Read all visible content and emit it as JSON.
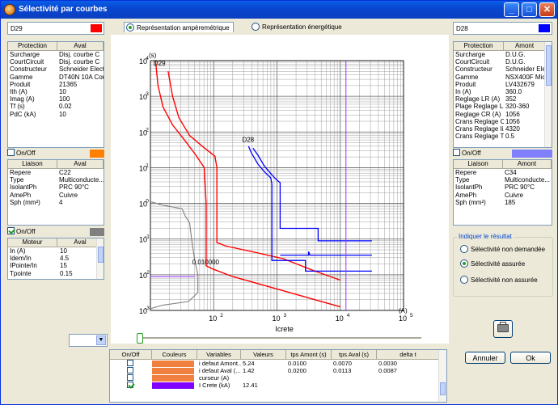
{
  "window": {
    "title": "Sélectivité par courbes"
  },
  "left": {
    "device_select": "D29",
    "prot_headers": [
      "Protection",
      "Aval"
    ],
    "prot_rows": [
      [
        "Surcharge",
        "Disj. courbe C"
      ],
      [
        "CourtCircuit",
        "Disj. courbe C"
      ],
      [
        "Constructeur",
        "Schneider Electric"
      ],
      [
        "Gamme",
        "DT40N 10A Cou..."
      ],
      [
        "Produit",
        "21365"
      ],
      [
        "Ith (A)",
        "10"
      ],
      [
        "Imag (A)",
        "100"
      ],
      [
        "Tf (s)",
        "0.02"
      ],
      [
        "PdC (kA)",
        "10"
      ]
    ],
    "onoff1": "On/Off",
    "liaison_headers": [
      "Liaison",
      "Aval"
    ],
    "liaison_rows": [
      [
        "Repere",
        "C22"
      ],
      [
        "Type",
        "Multiconducte..."
      ],
      [
        "IsolantPh",
        "PRC 90°C"
      ],
      [
        "AmePh",
        "Cuivre"
      ],
      [
        "Sph (mm²)",
        "4"
      ]
    ],
    "onoff2": "On/Off",
    "moteur_headers": [
      "Moteur",
      "Aval"
    ],
    "moteur_rows": [
      [
        "In (A)",
        "10"
      ],
      [
        "Idem/In",
        "4.5"
      ],
      [
        "IPointe/In",
        "15"
      ],
      [
        "Tpointe",
        "0.15"
      ]
    ],
    "zoom_select": ""
  },
  "right": {
    "device_select": "D28",
    "prot_headers": [
      "Protection",
      "Amont"
    ],
    "prot_rows": [
      [
        "Surcharge",
        "D.U.G."
      ],
      [
        "CourtCircuit",
        "D.U.G."
      ],
      [
        "Constructeur",
        "Schneider Elec"
      ],
      [
        "Gamme",
        "NSX400F Mic"
      ],
      [
        "Produit",
        "LV432679"
      ],
      [
        "In (A)",
        "360.0"
      ],
      [
        "Reglage LR (A)",
        "352"
      ],
      [
        "Plage Reglage L...",
        "320-360"
      ],
      [
        "Reglage CR (A)",
        "1056"
      ],
      [
        "Crans Reglage C...",
        "1056"
      ],
      [
        "Crans Reglage li...",
        "4320"
      ],
      [
        "Crans Reglage T...",
        "0.5"
      ]
    ],
    "onoff": "On/Off",
    "liaison_headers": [
      "Liaison",
      "Amont"
    ],
    "liaison_rows": [
      [
        "Repere",
        "C34"
      ],
      [
        "Type",
        "Multiconducte..."
      ],
      [
        "IsolantPh",
        "PRC 90°C"
      ],
      [
        "AmePh",
        "Cuivre"
      ],
      [
        "Sph (mm²)",
        "185"
      ]
    ],
    "result": {
      "legend": "Indiquer le résultat",
      "options": [
        "Sélectivité non demandée",
        "Sélectivité assurée",
        "Sélectivité non assurée"
      ],
      "selected": 1
    },
    "print_label": "",
    "cancel_label": "Annuler",
    "ok_label": "Ok"
  },
  "mode": {
    "options": [
      "Représentation ampèremétrique",
      "Représentation énergétique"
    ],
    "selected": 0
  },
  "chart": {
    "y_unit": "(s)",
    "x_unit": "(A)",
    "x_title": "Icrete",
    "y_ticks": [
      "10",
      "10",
      "10",
      "10",
      "10",
      "10",
      "10",
      "10"
    ],
    "y_exps": [
      "4",
      "3",
      "2",
      "1",
      "0",
      "-1",
      "-2",
      "-3"
    ],
    "x_ticks": [
      "10",
      "10",
      "10",
      "10"
    ],
    "x_exps": [
      "2",
      "3",
      "4",
      "5"
    ],
    "label_d29": "D29",
    "label_d28": "D28",
    "annotation": "0.010000"
  },
  "results": {
    "headers": [
      "On/Off",
      "Couleurs",
      "Variables",
      "Valeurs",
      "tps Amont (s)",
      "tps Aval (s)",
      "delta t"
    ],
    "rows": [
      {
        "checked": false,
        "color": "#f08040",
        "variable": "i defaut Amont...",
        "value": "5.24",
        "amont": "0.0100",
        "aval": "0.0070",
        "delta": "0.0030"
      },
      {
        "checked": false,
        "color": "#f08040",
        "variable": "i defaut Aval (...",
        "value": "1.42",
        "amont": "0.0200",
        "aval": "0.0113",
        "delta": "0.0087"
      },
      {
        "checked": false,
        "color": "#f08040",
        "variable": "curseur (A)",
        "value": "",
        "amont": "",
        "aval": "",
        "delta": ""
      },
      {
        "checked": true,
        "color": "#8000ff",
        "variable": "I Crete (kA)",
        "value": "12.41",
        "amont": "",
        "aval": "",
        "delta": ""
      }
    ]
  },
  "colors": {
    "d29": "#ff0000",
    "d28": "#0000ff",
    "gray_curve": "#808080",
    "cursor": "#9933ff",
    "left_onoff1": "#ff8000",
    "left_onoff2": "#808080",
    "right_onoff": "#8080ff"
  }
}
